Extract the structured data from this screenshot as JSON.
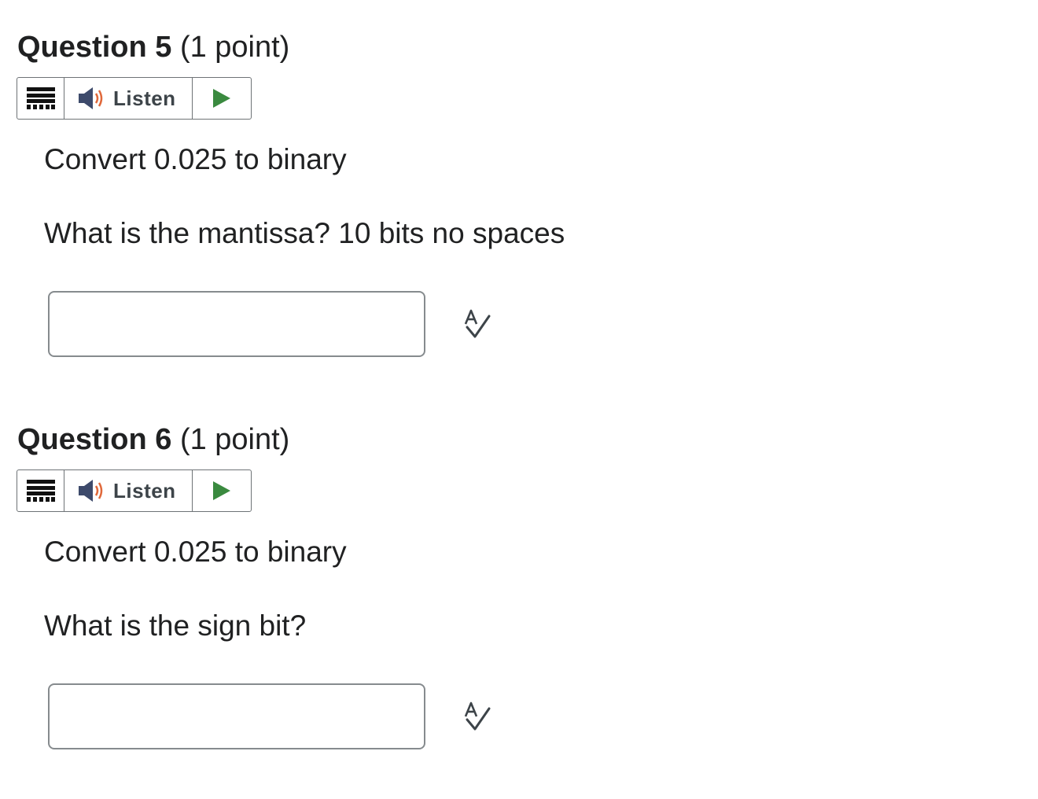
{
  "questions": [
    {
      "number_label": "Question 5",
      "points_label": "(1 point)",
      "listen_label": "Listen",
      "lines": [
        "Convert 0.025 to binary",
        "What is the mantissa? 10 bits no spaces"
      ],
      "answer_value": ""
    },
    {
      "number_label": "Question 6",
      "points_label": "(1 point)",
      "listen_label": "Listen",
      "lines": [
        "Convert 0.025 to binary",
        "What is the sign bit?"
      ],
      "answer_value": ""
    }
  ],
  "icons": {
    "menu": "hamburger-menu-icon",
    "speaker": "speaker-icon",
    "play": "play-icon",
    "spellcheck": "spell-check-icon"
  },
  "colors": {
    "play": "#3a8a3f",
    "speaker_body": "#3d4a6b",
    "speaker_waves": "#e0683a",
    "border": "#6e7376"
  }
}
